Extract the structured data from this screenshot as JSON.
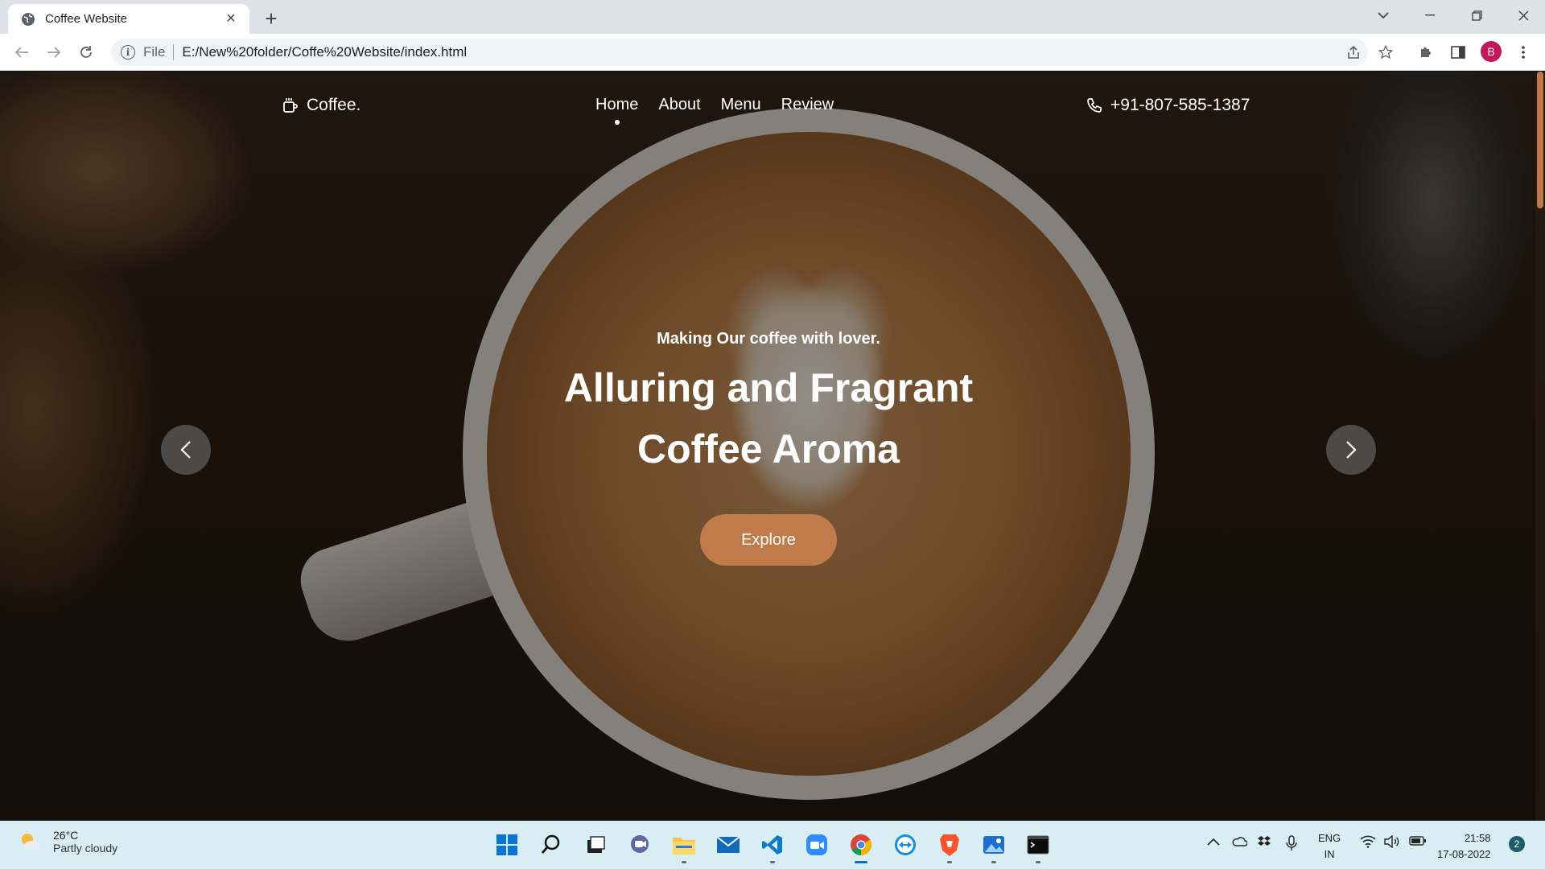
{
  "browser": {
    "tab_title": "Coffee Website",
    "new_tab_label": "+",
    "scheme_label": "File",
    "url": "E:/New%20folder/Coffe%20Website/index.html",
    "profile_initial": "B"
  },
  "site": {
    "logo_text": "Coffee.",
    "nav": [
      {
        "label": "Home",
        "active": true
      },
      {
        "label": "About",
        "active": false
      },
      {
        "label": "Menu",
        "active": false
      },
      {
        "label": "Review",
        "active": false
      }
    ],
    "phone": "+91-807-585-1387",
    "hero": {
      "subtitle": "Making Our coffee with lover.",
      "title_line1": "Alluring and Fragrant",
      "title_line2": "Coffee Aroma",
      "cta_label": "Explore"
    },
    "accent_color": "#c17a4a"
  },
  "taskbar": {
    "weather_temp": "26°C",
    "weather_condition": "Partly cloudy",
    "apps": [
      "start-icon",
      "search-icon",
      "task-view-icon",
      "chat-icon",
      "file-explorer-icon",
      "mail-icon",
      "vscode-icon",
      "zoom-icon",
      "chrome-icon",
      "teamviewer-icon",
      "brave-icon",
      "photos-icon",
      "terminal-icon"
    ],
    "language_line1": "ENG",
    "language_line2": "IN",
    "time": "21:58",
    "date": "17-08-2022",
    "notification_count": "2"
  }
}
